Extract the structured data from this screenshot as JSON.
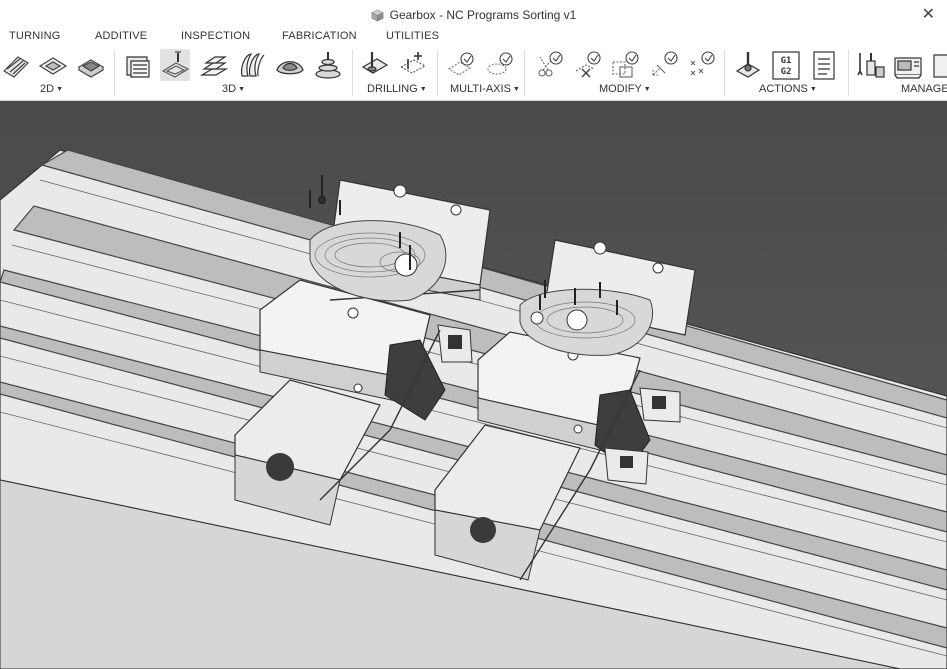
{
  "window": {
    "title": "Gearbox - NC Programs Sorting v1",
    "close_glyph": "✕"
  },
  "tabs": [
    {
      "label": "TURNING"
    },
    {
      "label": "ADDITIVE"
    },
    {
      "label": "INSPECTION"
    },
    {
      "label": "FABRICATION"
    },
    {
      "label": "UTILITIES"
    }
  ],
  "groups": {
    "g2d": {
      "label": "2D"
    },
    "g3d": {
      "label": "3D"
    },
    "drilling": {
      "label": "DRILLING"
    },
    "multiaxis": {
      "label": "MULTI-AXIS"
    },
    "modify": {
      "label": "MODIFY"
    },
    "actions": {
      "label": "ACTIONS",
      "gcode_line1": "G1",
      "gcode_line2": "G2"
    },
    "manage": {
      "label": "MANAGE"
    }
  },
  "colors": {
    "ribbon_bg": "#ffffff",
    "viewport_bg": "#505050",
    "active_tool_bg": "#e2e2e2",
    "accent": "#333333"
  }
}
